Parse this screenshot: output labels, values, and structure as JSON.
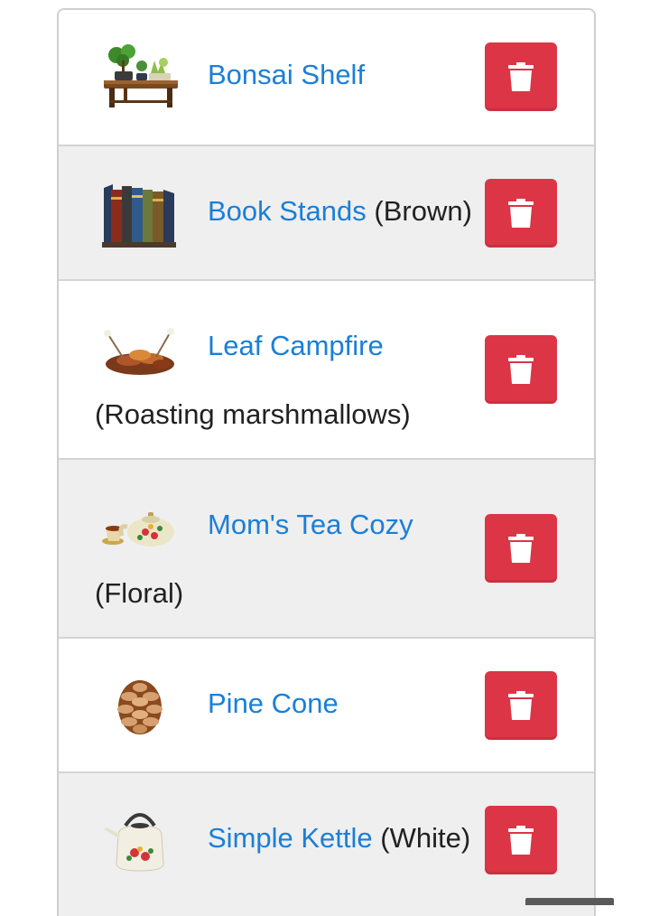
{
  "items": [
    {
      "name": "Bonsai Shelf",
      "variant": "",
      "icon": "bonsai-shelf-icon",
      "delete_icon": "trash-icon"
    },
    {
      "name": "Book Stands",
      "variant": "(Brown)",
      "icon": "book-stands-icon",
      "delete_icon": "trash-icon"
    },
    {
      "name": "Leaf Campfire",
      "variant": "(Roasting marshmallows)",
      "icon": "leaf-campfire-icon",
      "delete_icon": "trash-icon"
    },
    {
      "name": "Mom's Tea Cozy",
      "variant": "(Floral)",
      "icon": "tea-cozy-icon",
      "delete_icon": "trash-icon"
    },
    {
      "name": "Pine Cone",
      "variant": "",
      "icon": "pine-cone-icon",
      "delete_icon": "trash-icon"
    },
    {
      "name": "Simple Kettle",
      "variant": "(White)",
      "icon": "kettle-icon",
      "delete_icon": "trash-icon"
    }
  ],
  "colors": {
    "link": "#1a7fd8",
    "delete_button": "#dc3545",
    "row_alt": "#efefef",
    "border": "#d4d4d4"
  }
}
